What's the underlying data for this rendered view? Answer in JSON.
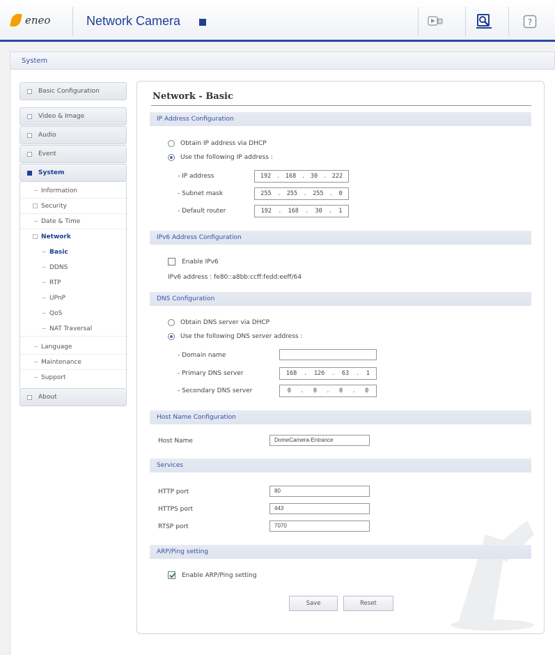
{
  "header": {
    "logo_text": "eneo",
    "app_title": "Network Camera",
    "icons": [
      "live-view-icon",
      "setup-icon",
      "help-icon"
    ]
  },
  "breadcrumb": "System",
  "sidebar": {
    "basic_configuration": "Basic Configuration",
    "items": [
      {
        "label": "Video & Image"
      },
      {
        "label": "Audio"
      },
      {
        "label": "Event"
      },
      {
        "label": "System"
      }
    ],
    "system_sub": [
      {
        "label": "Information"
      },
      {
        "label": "Security"
      },
      {
        "label": "Date & Time"
      },
      {
        "label": "Network"
      }
    ],
    "network_sub": [
      "Basic",
      "DDNS",
      "RTP",
      "UPnP",
      "QoS",
      "NAT Traversal"
    ],
    "system_sub_after": [
      "Language",
      "Maintenance",
      "Support"
    ],
    "about": "About"
  },
  "page": {
    "title": "Network - Basic",
    "ip_section": "IP Address Configuration",
    "dhcp_option": "Obtain IP address via DHCP",
    "static_option": "Use the following IP address :",
    "ip_label": "- IP address",
    "ip_value": [
      "192",
      "168",
      "30",
      "222"
    ],
    "subnet_label": "- Subnet mask",
    "subnet_value": [
      "255",
      "255",
      "255",
      "0"
    ],
    "router_label": "- Default router",
    "router_value": [
      "192",
      "168",
      "30",
      "1"
    ],
    "ipv6_section": "IPv6 Address Configuration",
    "enable_ipv6": "Enable IPv6",
    "enable_ipv6_checked": false,
    "ipv6_address": "IPv6 address : fe80::a8bb:ccff:fedd:eeff/64",
    "dns_section": "DNS Configuration",
    "dns_dhcp": "Obtain DNS server via DHCP",
    "dns_static": "Use the following DNS server address :",
    "domain_label": "- Domain name",
    "domain_value": "",
    "primary_label": "- Primary DNS server",
    "primary_value": [
      "168",
      "126",
      "63",
      "1"
    ],
    "secondary_label": "- Secondary DNS server",
    "secondary_value": [
      "0",
      "0",
      "0",
      "0"
    ],
    "host_section": "Host Name Configuration",
    "host_label": "Host Name",
    "host_value": "DomeCamera-Entrance",
    "services_section": "Services",
    "http_label": "HTTP port",
    "http_value": "80",
    "https_label": "HTTPS port",
    "https_value": "443",
    "rtsp_label": "RTSP port",
    "rtsp_value": "7070",
    "arp_section": "ARP/Ping setting",
    "arp_label": "Enable ARP/Ping setting",
    "arp_checked": true,
    "save": "Save",
    "reset": "Reset"
  },
  "colors": {
    "accent": "#1e3f94",
    "section_bg": "#e2e7f0",
    "logo_orange": "#f5a000"
  }
}
